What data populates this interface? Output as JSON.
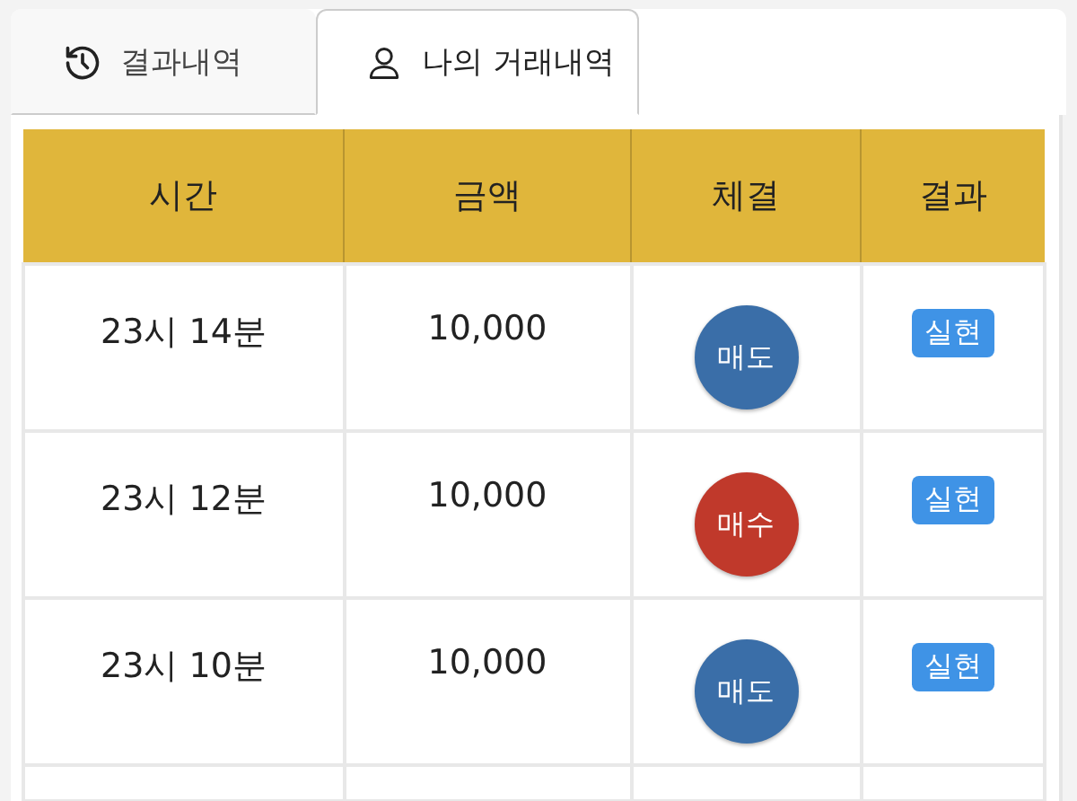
{
  "tabs": [
    {
      "label": "결과내역",
      "kind": "history",
      "selected": false
    },
    {
      "label": "나의 거래내역",
      "kind": "user",
      "selected": true
    }
  ],
  "table": {
    "columns": [
      "시간",
      "금액",
      "체결",
      "결과"
    ],
    "rows": [
      {
        "time": "23시 14분",
        "amount": "10,000",
        "trade": {
          "kind": "sell",
          "label": "매도"
        },
        "result": "실현"
      },
      {
        "time": "23시 12분",
        "amount": "10,000",
        "trade": {
          "kind": "buy",
          "label": "매수"
        },
        "result": "실현"
      },
      {
        "time": "23시 10분",
        "amount": "10,000",
        "trade": {
          "kind": "sell",
          "label": "매도"
        },
        "result": "실현"
      }
    ]
  }
}
